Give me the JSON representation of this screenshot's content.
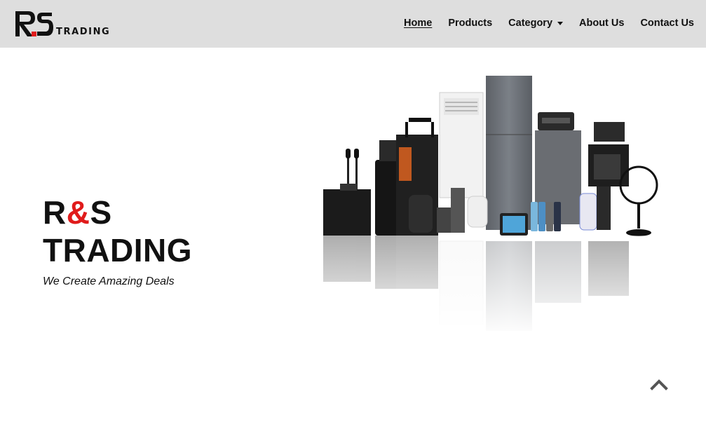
{
  "brand": {
    "logo_mark": "RS",
    "wordmark": "TRADING",
    "mark_color": "#111111",
    "accent_color": "#e01b1b"
  },
  "nav": {
    "items": [
      {
        "label": "Home",
        "active": true
      },
      {
        "label": "Products",
        "active": false
      },
      {
        "label": "Category",
        "active": false,
        "has_dropdown": true
      },
      {
        "label": "About Us",
        "active": false
      },
      {
        "label": "Contact Us",
        "active": false
      }
    ],
    "background": "#dedede"
  },
  "hero": {
    "title_part1": "R",
    "title_amp": "&",
    "title_part2": "S",
    "title_line2": "TRADING",
    "tagline": "We Create Amazing Deals",
    "image_icon": "appliances-image"
  },
  "scroll_top": {
    "icon": "chevron-up-icon"
  }
}
